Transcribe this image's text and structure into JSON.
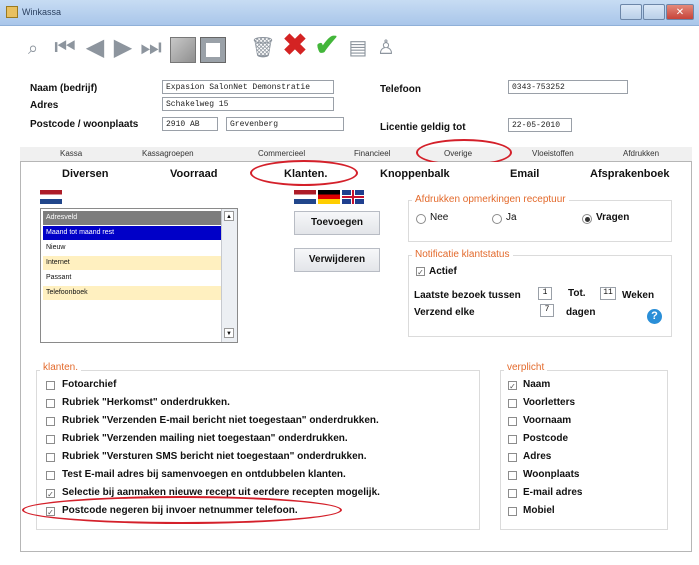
{
  "window": {
    "title": "Winkassa",
    "close_glyph": "✕"
  },
  "toolbar": {
    "icons": [
      "search-icon",
      "first-record-icon",
      "previous-record-icon",
      "next-record-icon",
      "last-record-icon",
      "edit-icon",
      "new-record-icon",
      "delete-trash-icon",
      "cancel-x-icon",
      "confirm-check-icon",
      "print-icon",
      "user-icon"
    ]
  },
  "form": {
    "company_label": "Naam (bedrijf)",
    "company_value": "Expasion SalonNet Demonstratie",
    "address_label": "Adres",
    "address_value": "Schakelweg 15",
    "postcode_label": "Postcode / woonplaats",
    "postcode_value": "2910 AB",
    "city_value": "Grevenberg",
    "phone_label": "Telefoon",
    "phone_value": "0343-753252",
    "license_label": "Licentie geldig tot",
    "license_value": "22-05-2010"
  },
  "tabs_main": [
    "Kassa",
    "Kassagroepen",
    "Commercieel",
    "Financieel",
    "Overige",
    "Vloeistoffen",
    "Afdrukken"
  ],
  "tabs_sub": [
    "Diversen",
    "Voorraad",
    "Klanten.",
    "Knoppenbalk",
    "Email",
    "Afsprakenboek"
  ],
  "list": {
    "items": [
      {
        "label": "Adresveld",
        "state": "header"
      },
      {
        "label": "Maand tot maand rest",
        "state": "selected"
      },
      {
        "label": "Nieuw",
        "state": "normal"
      },
      {
        "label": "Internet",
        "state": "highlight"
      },
      {
        "label": "Passant",
        "state": "normal"
      },
      {
        "label": "Telefoonboek",
        "state": "highlight"
      }
    ]
  },
  "buttons": {
    "add": "Toevoegen",
    "remove": "Verwijderen"
  },
  "print_group": {
    "title": "Afdrukken opmerkingen receptuur",
    "options": [
      "Nee",
      "Ja",
      "Vragen"
    ],
    "selected": "Vragen"
  },
  "status_group": {
    "title": "Notificatie klantstatus",
    "active_label": "Actief",
    "active_checked": true,
    "last_visit_label": "Laatste bezoek tussen",
    "from_value": "1",
    "to_label": "Tot.",
    "to_value": "11",
    "weeks_label": "Weken",
    "send_label": "Verzend elke",
    "days_value": "7",
    "days_label": "dagen",
    "help_glyph": "?"
  },
  "klanten_group": {
    "title": "klanten.",
    "options": [
      {
        "label": "Fotoarchief",
        "checked": false
      },
      {
        "label": "Rubriek \"Herkomst\" onderdrukken.",
        "checked": false
      },
      {
        "label": "Rubriek \"Verzenden E-mail bericht niet toegestaan\" onderdrukken.",
        "checked": false
      },
      {
        "label": "Rubriek \"Verzenden mailing niet toegestaan\" onderdrukken.",
        "checked": false
      },
      {
        "label": "Rubriek \"Versturen SMS bericht niet toegestaan\" onderdrukken.",
        "checked": false
      },
      {
        "label": "Test E-mail adres bij samenvoegen en ontdubbelen klanten.",
        "checked": false
      },
      {
        "label": "Selectie bij aanmaken nieuwe recept uit eerdere recepten mogelijk.",
        "checked": true
      },
      {
        "label": "Postcode negeren bij invoer netnummer telefoon.",
        "checked": true
      }
    ]
  },
  "verplicht_group": {
    "title": "verplicht",
    "options": [
      {
        "label": "Naam",
        "checked": true
      },
      {
        "label": "Voorletters",
        "checked": false
      },
      {
        "label": "Voornaam",
        "checked": false
      },
      {
        "label": "Postcode",
        "checked": false
      },
      {
        "label": "Adres",
        "checked": false
      },
      {
        "label": "Woonplaats",
        "checked": false
      },
      {
        "label": "E-mail adres",
        "checked": false
      },
      {
        "label": "Mobiel",
        "checked": false
      }
    ]
  },
  "colors": {
    "accent_orange": "#e36a2c",
    "highlight_red": "#d4202a",
    "selected_blue": "#0000c8",
    "list_highlight": "#fff0c0",
    "header_gray": "#7d7d7d"
  }
}
